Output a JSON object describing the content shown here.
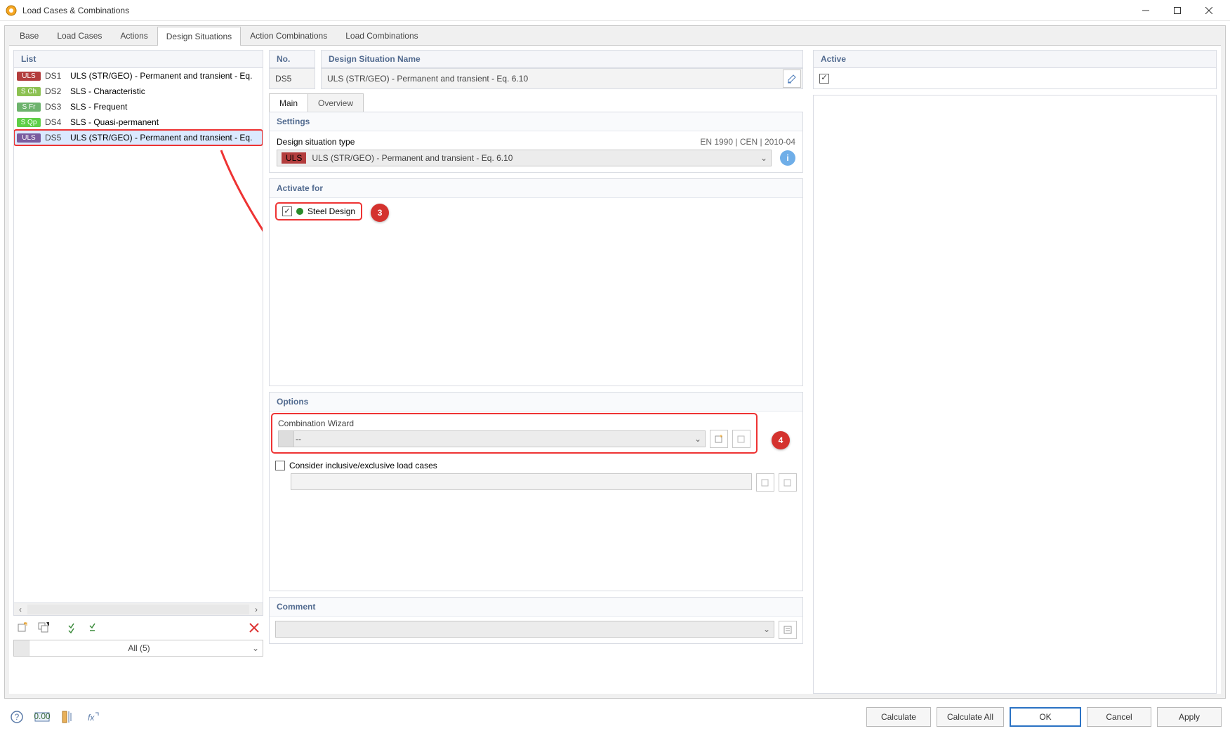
{
  "window": {
    "title": "Load Cases & Combinations"
  },
  "tabs": {
    "items": [
      "Base",
      "Load Cases",
      "Actions",
      "Design Situations",
      "Action Combinations",
      "Load Combinations"
    ],
    "active": 3
  },
  "list": {
    "header": "List",
    "items": [
      {
        "tag": "ULS",
        "tagClass": "tag-uls",
        "id": "DS1",
        "name": "ULS (STR/GEO) - Permanent and transient - Eq."
      },
      {
        "tag": "S Ch",
        "tagClass": "tag-sch",
        "id": "DS2",
        "name": "SLS - Characteristic"
      },
      {
        "tag": "S Fr",
        "tagClass": "tag-sfr",
        "id": "DS3",
        "name": "SLS - Frequent"
      },
      {
        "tag": "S Qp",
        "tagClass": "tag-sop",
        "id": "DS4",
        "name": "SLS - Quasi-permanent"
      },
      {
        "tag": "ULS",
        "tagClass": "tag-uls-sel",
        "id": "DS5",
        "name": "ULS (STR/GEO) - Permanent and transient - Eq.",
        "selected": true
      }
    ],
    "filter": "All (5)"
  },
  "header_fields": {
    "no_label": "No.",
    "no_value": "DS5",
    "name_label": "Design Situation Name",
    "name_value": "ULS (STR/GEO) - Permanent and transient - Eq. 6.10",
    "active_label": "Active",
    "active_checked": true
  },
  "inner_tabs": {
    "items": [
      "Main",
      "Overview"
    ],
    "active": 0
  },
  "settings": {
    "header": "Settings",
    "type_label": "Design situation type",
    "type_ref": "EN 1990 | CEN | 2010-04",
    "type_tag": "ULS",
    "type_value": "ULS (STR/GEO) - Permanent and transient - Eq. 6.10"
  },
  "activate": {
    "header": "Activate for",
    "steel_label": "Steel Design",
    "steel_checked": true,
    "badge": "3"
  },
  "options": {
    "header": "Options",
    "wizard_label": "Combination Wizard",
    "wizard_value": "--",
    "consider_label": "Consider inclusive/exclusive load cases",
    "consider_checked": false,
    "badge": "4"
  },
  "comment": {
    "header": "Comment",
    "value": ""
  },
  "footer": {
    "calculate": "Calculate",
    "calculate_all": "Calculate All",
    "ok": "OK",
    "cancel": "Cancel",
    "apply": "Apply"
  }
}
